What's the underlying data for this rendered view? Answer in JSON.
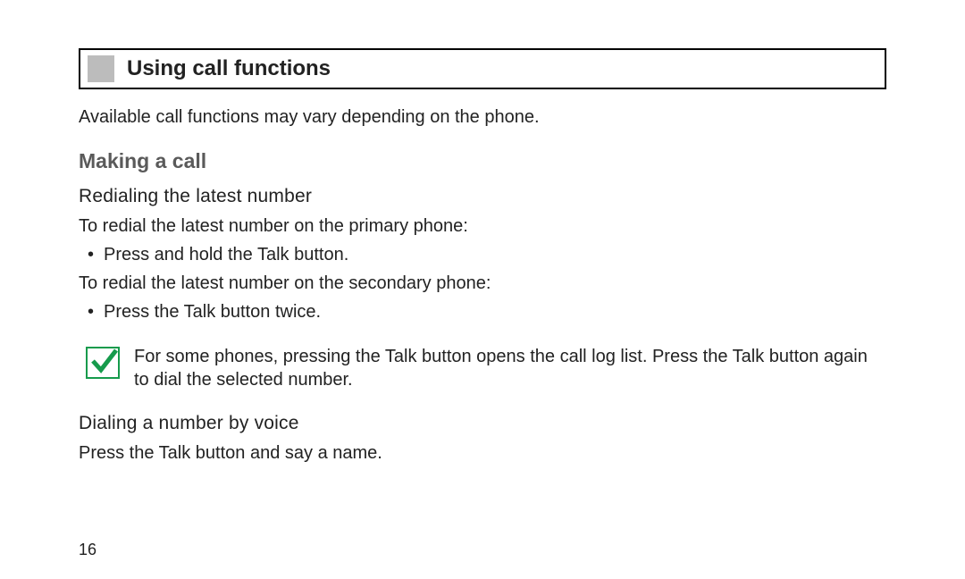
{
  "heading": "Using call functions",
  "intro": "Available call functions may vary depending on the phone.",
  "section1": {
    "title": "Making a call",
    "sub1_title": "Redialing the latest number",
    "primary_label": "To redial the latest number on the primary phone:",
    "primary_bullet": "Press and hold the Talk button.",
    "secondary_label": "To redial the latest number on the secondary phone:",
    "secondary_bullet": "Press the Talk button twice.",
    "note_text": "For some phones, pressing the Talk button opens the call log list. Press the Talk button again to dial the selected number.",
    "sub2_title": "Dialing a number by voice",
    "sub2_body": "Press the Talk button and say a name."
  },
  "page_number": "16"
}
